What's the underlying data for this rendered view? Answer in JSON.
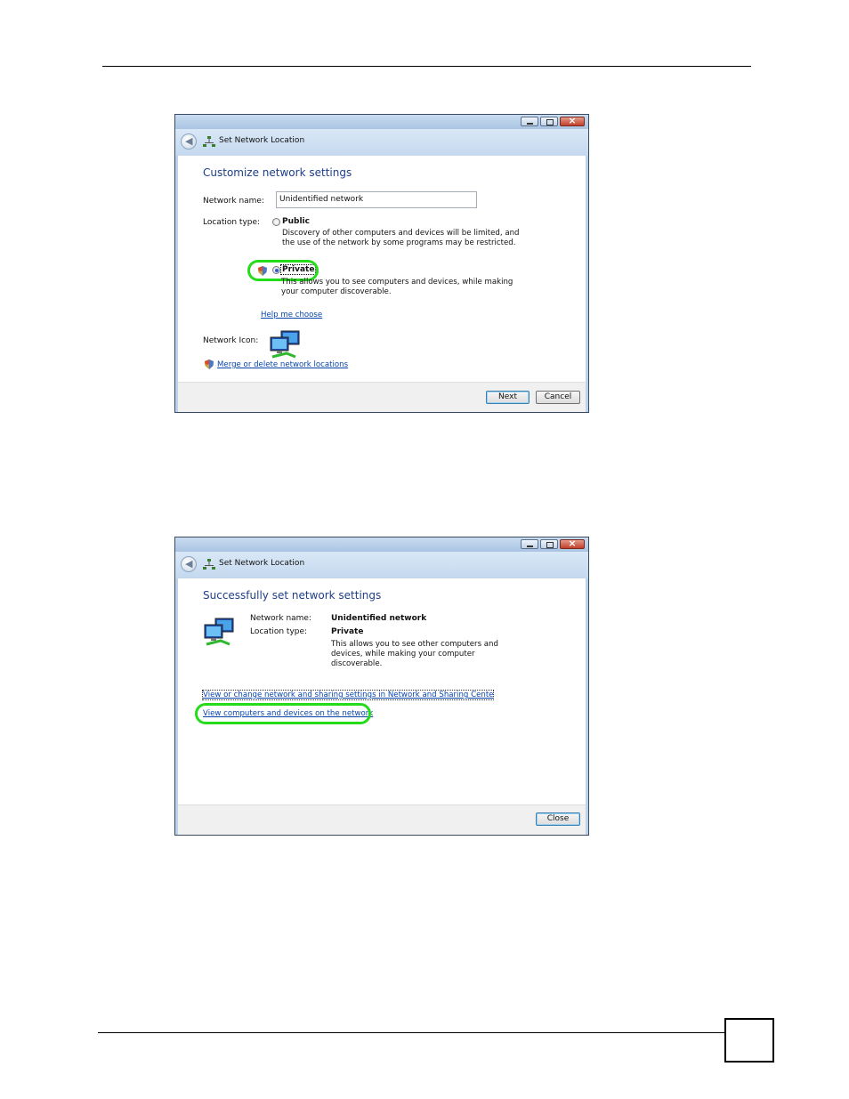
{
  "dialog1": {
    "title": "Set Network Location",
    "heading": "Customize network settings",
    "network_name_label": "Network name:",
    "network_name_value": "Unidentified network",
    "location_type_label": "Location type:",
    "public_label": "Public",
    "public_desc_line1": "Discovery of other computers and devices will be limited, and",
    "public_desc_line2": "the use of the network by some programs may be restricted.",
    "private_label": "Private",
    "private_desc_line1": "This allows you to see computers and devices, while making",
    "private_desc_line2": "your computer discoverable.",
    "selected_location": "Private",
    "help_link": "Help me choose",
    "network_icon_label": "Network Icon:",
    "merge_link": "Merge or delete network locations",
    "next_button": "Next",
    "cancel_button": "Cancel"
  },
  "dialog2": {
    "title": "Set Network Location",
    "heading": "Successfully set network settings",
    "network_name_label": "Network name:",
    "network_name_value": "Unidentified network",
    "location_type_label": "Location type:",
    "location_type_value": "Private",
    "desc_line1": "This allows you to see other computers and",
    "desc_line2": "devices, while making your computer",
    "desc_line3": "discoverable.",
    "sharing_center_link": "View or change network and sharing settings in Network and Sharing Cente",
    "view_computers_link": "View computers and devices on the network",
    "close_button": "Close"
  },
  "colors": {
    "highlight": "#25dc1a",
    "heading": "#1e3e8a",
    "link": "#0645ad"
  },
  "icons": [
    "back-arrow-icon",
    "network-icon",
    "shield-icon",
    "computers-network-icon",
    "minimize-icon",
    "maximize-icon",
    "close-icon"
  ]
}
